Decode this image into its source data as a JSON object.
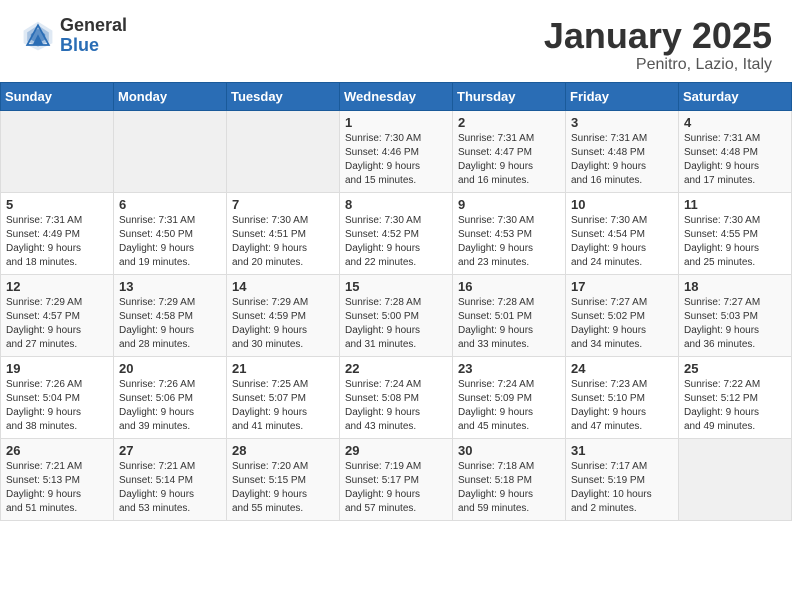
{
  "header": {
    "logo_general": "General",
    "logo_blue": "Blue",
    "title": "January 2025",
    "subtitle": "Penitro, Lazio, Italy"
  },
  "days_of_week": [
    "Sunday",
    "Monday",
    "Tuesday",
    "Wednesday",
    "Thursday",
    "Friday",
    "Saturday"
  ],
  "weeks": [
    [
      {
        "day": "",
        "info": ""
      },
      {
        "day": "",
        "info": ""
      },
      {
        "day": "",
        "info": ""
      },
      {
        "day": "1",
        "info": "Sunrise: 7:30 AM\nSunset: 4:46 PM\nDaylight: 9 hours\nand 15 minutes."
      },
      {
        "day": "2",
        "info": "Sunrise: 7:31 AM\nSunset: 4:47 PM\nDaylight: 9 hours\nand 16 minutes."
      },
      {
        "day": "3",
        "info": "Sunrise: 7:31 AM\nSunset: 4:48 PM\nDaylight: 9 hours\nand 16 minutes."
      },
      {
        "day": "4",
        "info": "Sunrise: 7:31 AM\nSunset: 4:48 PM\nDaylight: 9 hours\nand 17 minutes."
      }
    ],
    [
      {
        "day": "5",
        "info": "Sunrise: 7:31 AM\nSunset: 4:49 PM\nDaylight: 9 hours\nand 18 minutes."
      },
      {
        "day": "6",
        "info": "Sunrise: 7:31 AM\nSunset: 4:50 PM\nDaylight: 9 hours\nand 19 minutes."
      },
      {
        "day": "7",
        "info": "Sunrise: 7:30 AM\nSunset: 4:51 PM\nDaylight: 9 hours\nand 20 minutes."
      },
      {
        "day": "8",
        "info": "Sunrise: 7:30 AM\nSunset: 4:52 PM\nDaylight: 9 hours\nand 22 minutes."
      },
      {
        "day": "9",
        "info": "Sunrise: 7:30 AM\nSunset: 4:53 PM\nDaylight: 9 hours\nand 23 minutes."
      },
      {
        "day": "10",
        "info": "Sunrise: 7:30 AM\nSunset: 4:54 PM\nDaylight: 9 hours\nand 24 minutes."
      },
      {
        "day": "11",
        "info": "Sunrise: 7:30 AM\nSunset: 4:55 PM\nDaylight: 9 hours\nand 25 minutes."
      }
    ],
    [
      {
        "day": "12",
        "info": "Sunrise: 7:29 AM\nSunset: 4:57 PM\nDaylight: 9 hours\nand 27 minutes."
      },
      {
        "day": "13",
        "info": "Sunrise: 7:29 AM\nSunset: 4:58 PM\nDaylight: 9 hours\nand 28 minutes."
      },
      {
        "day": "14",
        "info": "Sunrise: 7:29 AM\nSunset: 4:59 PM\nDaylight: 9 hours\nand 30 minutes."
      },
      {
        "day": "15",
        "info": "Sunrise: 7:28 AM\nSunset: 5:00 PM\nDaylight: 9 hours\nand 31 minutes."
      },
      {
        "day": "16",
        "info": "Sunrise: 7:28 AM\nSunset: 5:01 PM\nDaylight: 9 hours\nand 33 minutes."
      },
      {
        "day": "17",
        "info": "Sunrise: 7:27 AM\nSunset: 5:02 PM\nDaylight: 9 hours\nand 34 minutes."
      },
      {
        "day": "18",
        "info": "Sunrise: 7:27 AM\nSunset: 5:03 PM\nDaylight: 9 hours\nand 36 minutes."
      }
    ],
    [
      {
        "day": "19",
        "info": "Sunrise: 7:26 AM\nSunset: 5:04 PM\nDaylight: 9 hours\nand 38 minutes."
      },
      {
        "day": "20",
        "info": "Sunrise: 7:26 AM\nSunset: 5:06 PM\nDaylight: 9 hours\nand 39 minutes."
      },
      {
        "day": "21",
        "info": "Sunrise: 7:25 AM\nSunset: 5:07 PM\nDaylight: 9 hours\nand 41 minutes."
      },
      {
        "day": "22",
        "info": "Sunrise: 7:24 AM\nSunset: 5:08 PM\nDaylight: 9 hours\nand 43 minutes."
      },
      {
        "day": "23",
        "info": "Sunrise: 7:24 AM\nSunset: 5:09 PM\nDaylight: 9 hours\nand 45 minutes."
      },
      {
        "day": "24",
        "info": "Sunrise: 7:23 AM\nSunset: 5:10 PM\nDaylight: 9 hours\nand 47 minutes."
      },
      {
        "day": "25",
        "info": "Sunrise: 7:22 AM\nSunset: 5:12 PM\nDaylight: 9 hours\nand 49 minutes."
      }
    ],
    [
      {
        "day": "26",
        "info": "Sunrise: 7:21 AM\nSunset: 5:13 PM\nDaylight: 9 hours\nand 51 minutes."
      },
      {
        "day": "27",
        "info": "Sunrise: 7:21 AM\nSunset: 5:14 PM\nDaylight: 9 hours\nand 53 minutes."
      },
      {
        "day": "28",
        "info": "Sunrise: 7:20 AM\nSunset: 5:15 PM\nDaylight: 9 hours\nand 55 minutes."
      },
      {
        "day": "29",
        "info": "Sunrise: 7:19 AM\nSunset: 5:17 PM\nDaylight: 9 hours\nand 57 minutes."
      },
      {
        "day": "30",
        "info": "Sunrise: 7:18 AM\nSunset: 5:18 PM\nDaylight: 9 hours\nand 59 minutes."
      },
      {
        "day": "31",
        "info": "Sunrise: 7:17 AM\nSunset: 5:19 PM\nDaylight: 10 hours\nand 2 minutes."
      },
      {
        "day": "",
        "info": ""
      }
    ]
  ]
}
